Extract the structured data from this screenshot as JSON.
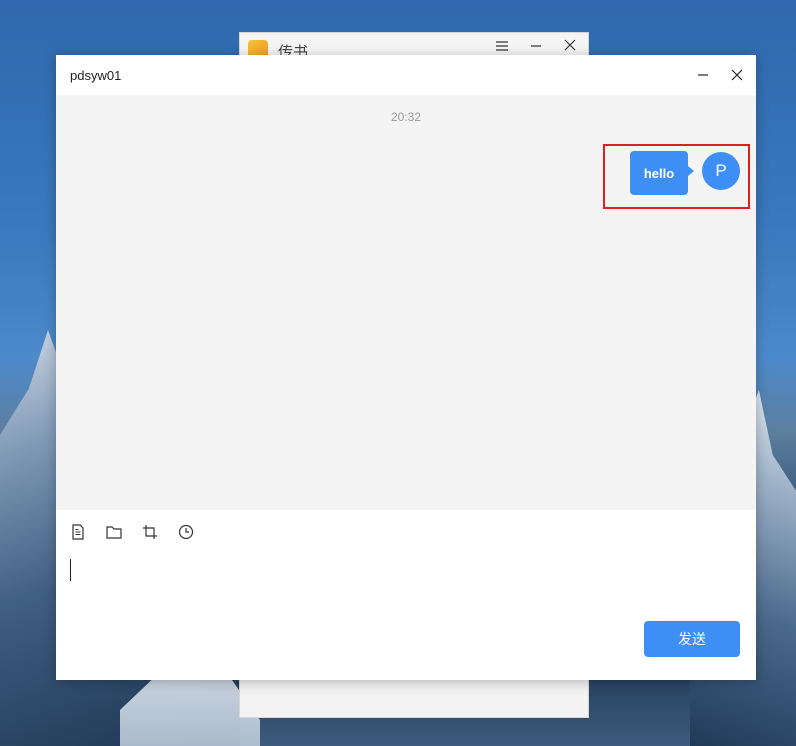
{
  "background_window": {
    "title": "传书",
    "icons": [
      "app-logo-icon",
      "menu-icon",
      "minimize-icon",
      "close-icon"
    ]
  },
  "chat_window": {
    "title": "pdsyw01",
    "icons": [
      "minimize-icon",
      "close-icon"
    ]
  },
  "messages": {
    "timestamp": "20:32",
    "items": [
      {
        "sender_initial": "P",
        "text": "hello",
        "side": "right"
      }
    ]
  },
  "composer": {
    "toolbar_icons": [
      "file-icon",
      "folder-icon",
      "crop-icon",
      "history-icon"
    ],
    "input_value": "",
    "send_label": "发送"
  },
  "colors": {
    "accent": "#3d8ef5",
    "highlight_border": "#e02020",
    "message_area_bg": "#f4f4f4"
  }
}
